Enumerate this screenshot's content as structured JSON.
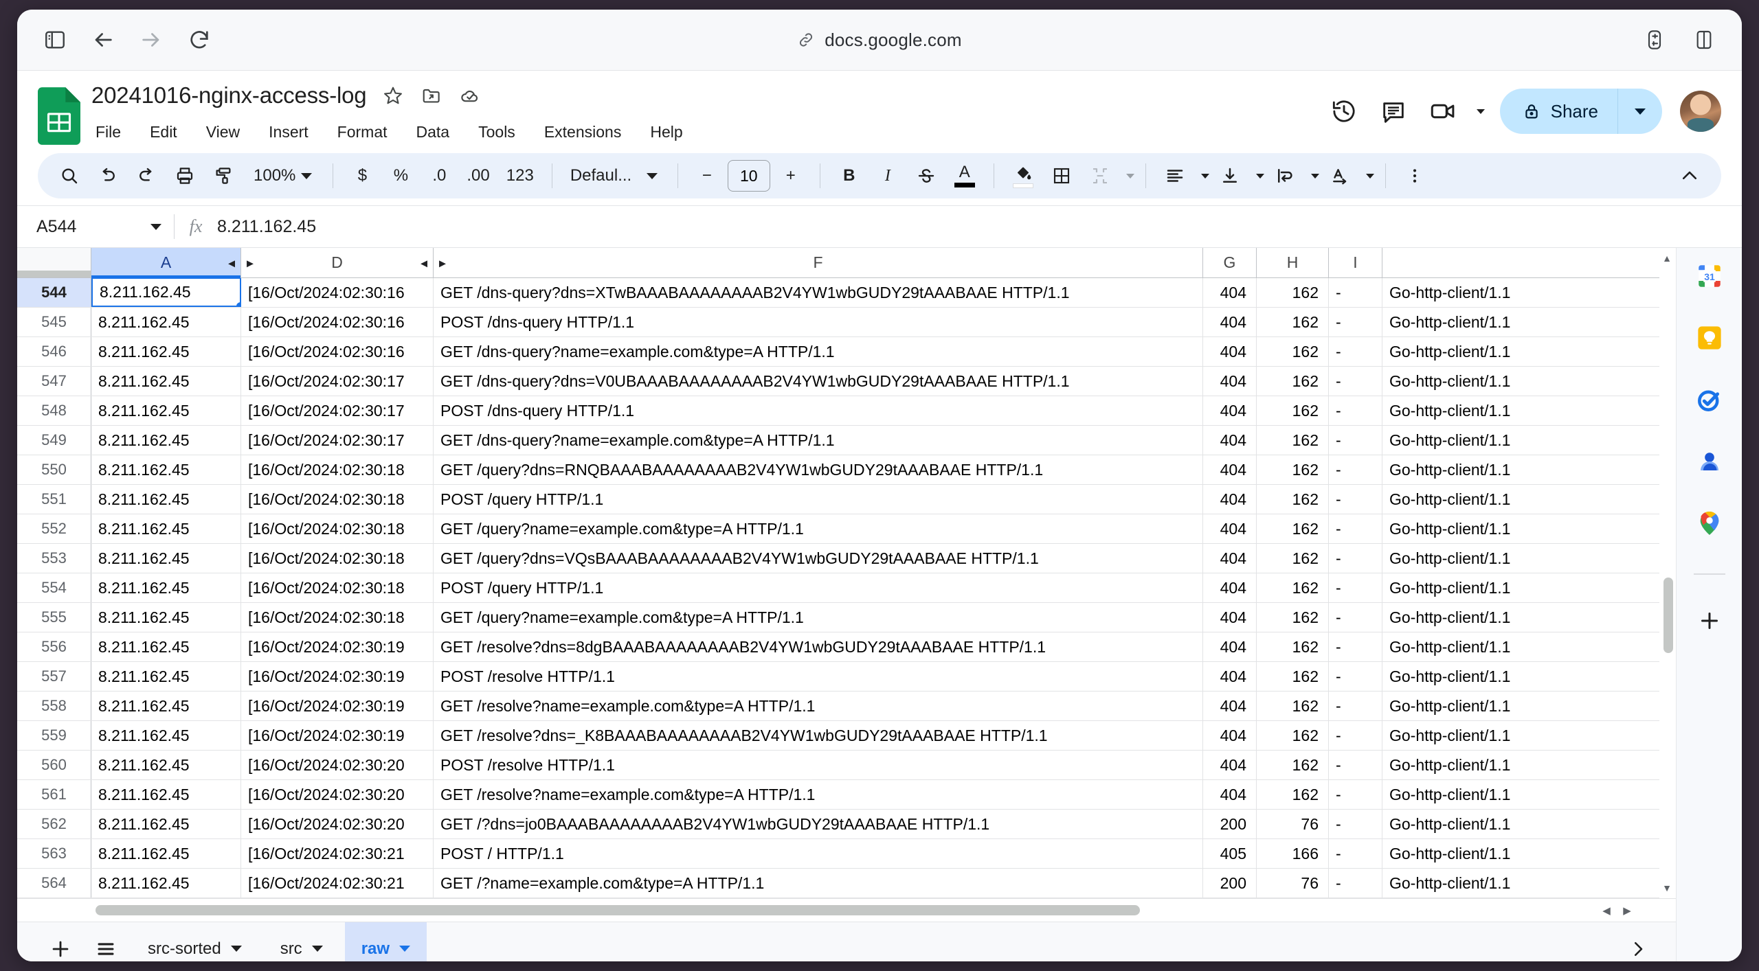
{
  "browser": {
    "url": "docs.google.com",
    "back_label": "Back",
    "forward_label": "Forward",
    "reload_label": "Reload",
    "sidebar_toggle_label": "Show sidebar"
  },
  "doc": {
    "title": "20241016-nginx-access-log",
    "menus": [
      "File",
      "Edit",
      "View",
      "Insert",
      "Format",
      "Data",
      "Tools",
      "Extensions",
      "Help"
    ],
    "share_label": "Share"
  },
  "toolbar": {
    "zoom": "100%",
    "font": "Defaul...",
    "font_size": "10",
    "bold": "B",
    "italic": "I",
    "strikethrough": "S",
    "text_color": "A",
    "currency": "$",
    "percent": "%",
    "decimal_decrease": ".0",
    "decimal_increase": ".00",
    "number_format": "123",
    "minus": "−",
    "plus": "+"
  },
  "formula_bar": {
    "name_box": "A544",
    "fx": "fx",
    "value": "8.211.162.45"
  },
  "grid": {
    "columns": [
      "A",
      "D",
      "F",
      "G",
      "H",
      "I",
      ""
    ],
    "selected_column": "A",
    "selected_cell": "A544",
    "rows": [
      {
        "n": "544",
        "a": "8.211.162.45",
        "d": "[16/Oct/2024:02:30:16",
        "f": "GET /dns-query?dns=XTwBAAABAAAAAAAAB2V4YW1wbGUDY29tAAABAAE HTTP/1.1",
        "g": "404",
        "h": "162",
        "i": "-",
        "j": "Go-http-client/1.1"
      },
      {
        "n": "545",
        "a": "8.211.162.45",
        "d": "[16/Oct/2024:02:30:16",
        "f": "POST /dns-query HTTP/1.1",
        "g": "404",
        "h": "162",
        "i": "-",
        "j": "Go-http-client/1.1"
      },
      {
        "n": "546",
        "a": "8.211.162.45",
        "d": "[16/Oct/2024:02:30:16",
        "f": "GET /dns-query?name=example.com&type=A HTTP/1.1",
        "g": "404",
        "h": "162",
        "i": "-",
        "j": "Go-http-client/1.1"
      },
      {
        "n": "547",
        "a": "8.211.162.45",
        "d": "[16/Oct/2024:02:30:17",
        "f": "GET /dns-query?dns=V0UBAAABAAAAAAAAB2V4YW1wbGUDY29tAAABAAE HTTP/1.1",
        "g": "404",
        "h": "162",
        "i": "-",
        "j": "Go-http-client/1.1"
      },
      {
        "n": "548",
        "a": "8.211.162.45",
        "d": "[16/Oct/2024:02:30:17",
        "f": "POST /dns-query HTTP/1.1",
        "g": "404",
        "h": "162",
        "i": "-",
        "j": "Go-http-client/1.1"
      },
      {
        "n": "549",
        "a": "8.211.162.45",
        "d": "[16/Oct/2024:02:30:17",
        "f": "GET /dns-query?name=example.com&type=A HTTP/1.1",
        "g": "404",
        "h": "162",
        "i": "-",
        "j": "Go-http-client/1.1"
      },
      {
        "n": "550",
        "a": "8.211.162.45",
        "d": "[16/Oct/2024:02:30:18",
        "f": "GET /query?dns=RNQBAAABAAAAAAAAB2V4YW1wbGUDY29tAAABAAE HTTP/1.1",
        "g": "404",
        "h": "162",
        "i": "-",
        "j": "Go-http-client/1.1"
      },
      {
        "n": "551",
        "a": "8.211.162.45",
        "d": "[16/Oct/2024:02:30:18",
        "f": "POST /query HTTP/1.1",
        "g": "404",
        "h": "162",
        "i": "-",
        "j": "Go-http-client/1.1"
      },
      {
        "n": "552",
        "a": "8.211.162.45",
        "d": "[16/Oct/2024:02:30:18",
        "f": "GET /query?name=example.com&type=A HTTP/1.1",
        "g": "404",
        "h": "162",
        "i": "-",
        "j": "Go-http-client/1.1"
      },
      {
        "n": "553",
        "a": "8.211.162.45",
        "d": "[16/Oct/2024:02:30:18",
        "f": "GET /query?dns=VQsBAAABAAAAAAAAB2V4YW1wbGUDY29tAAABAAE HTTP/1.1",
        "g": "404",
        "h": "162",
        "i": "-",
        "j": "Go-http-client/1.1"
      },
      {
        "n": "554",
        "a": "8.211.162.45",
        "d": "[16/Oct/2024:02:30:18",
        "f": "POST /query HTTP/1.1",
        "g": "404",
        "h": "162",
        "i": "-",
        "j": "Go-http-client/1.1"
      },
      {
        "n": "555",
        "a": "8.211.162.45",
        "d": "[16/Oct/2024:02:30:18",
        "f": "GET /query?name=example.com&type=A HTTP/1.1",
        "g": "404",
        "h": "162",
        "i": "-",
        "j": "Go-http-client/1.1"
      },
      {
        "n": "556",
        "a": "8.211.162.45",
        "d": "[16/Oct/2024:02:30:19",
        "f": "GET /resolve?dns=8dgBAAABAAAAAAAAB2V4YW1wbGUDY29tAAABAAE HTTP/1.1",
        "g": "404",
        "h": "162",
        "i": "-",
        "j": "Go-http-client/1.1"
      },
      {
        "n": "557",
        "a": "8.211.162.45",
        "d": "[16/Oct/2024:02:30:19",
        "f": "POST /resolve HTTP/1.1",
        "g": "404",
        "h": "162",
        "i": "-",
        "j": "Go-http-client/1.1"
      },
      {
        "n": "558",
        "a": "8.211.162.45",
        "d": "[16/Oct/2024:02:30:19",
        "f": "GET /resolve?name=example.com&type=A HTTP/1.1",
        "g": "404",
        "h": "162",
        "i": "-",
        "j": "Go-http-client/1.1"
      },
      {
        "n": "559",
        "a": "8.211.162.45",
        "d": "[16/Oct/2024:02:30:19",
        "f": "GET /resolve?dns=_K8BAAABAAAAAAAAB2V4YW1wbGUDY29tAAABAAE HTTP/1.1",
        "g": "404",
        "h": "162",
        "i": "-",
        "j": "Go-http-client/1.1"
      },
      {
        "n": "560",
        "a": "8.211.162.45",
        "d": "[16/Oct/2024:02:30:20",
        "f": "POST /resolve HTTP/1.1",
        "g": "404",
        "h": "162",
        "i": "-",
        "j": "Go-http-client/1.1"
      },
      {
        "n": "561",
        "a": "8.211.162.45",
        "d": "[16/Oct/2024:02:30:20",
        "f": "GET /resolve?name=example.com&type=A HTTP/1.1",
        "g": "404",
        "h": "162",
        "i": "-",
        "j": "Go-http-client/1.1"
      },
      {
        "n": "562",
        "a": "8.211.162.45",
        "d": "[16/Oct/2024:02:30:20",
        "f": "GET /?dns=jo0BAAABAAAAAAAAB2V4YW1wbGUDY29tAAABAAE HTTP/1.1",
        "g": "200",
        "h": "76",
        "i": "-",
        "j": "Go-http-client/1.1"
      },
      {
        "n": "563",
        "a": "8.211.162.45",
        "d": "[16/Oct/2024:02:30:21",
        "f": "POST / HTTP/1.1",
        "g": "405",
        "h": "166",
        "i": "-",
        "j": "Go-http-client/1.1"
      },
      {
        "n": "564",
        "a": "8.211.162.45",
        "d": "[16/Oct/2024:02:30:21",
        "f": "GET /?name=example.com&type=A HTTP/1.1",
        "g": "200",
        "h": "76",
        "i": "-",
        "j": "Go-http-client/1.1"
      }
    ]
  },
  "sheet_tabs": {
    "add_label": "+",
    "all_sheets_label": "≡",
    "tabs": [
      {
        "label": "src-sorted",
        "active": false
      },
      {
        "label": "src",
        "active": false
      },
      {
        "label": "raw",
        "active": true
      }
    ]
  },
  "side_panel": {
    "items": [
      "calendar-icon",
      "keep-icon",
      "tasks-icon",
      "contacts-icon",
      "maps-icon"
    ],
    "add_label": "+"
  },
  "colors": {
    "accent": "#1a73e8",
    "selection_header": "#c6dafc",
    "share_bg": "#c2e7ff",
    "toolbar_bg": "#eaf1fb",
    "sheets_green": "#0f9d58"
  }
}
